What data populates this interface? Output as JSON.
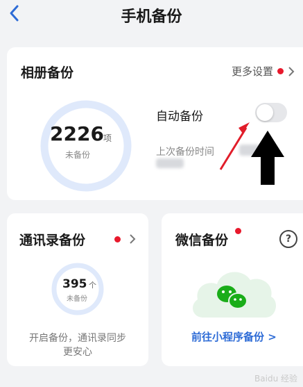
{
  "header": {
    "title": "手机备份"
  },
  "album": {
    "title": "相册备份",
    "more_label": "更多设置",
    "count": "2226",
    "unit": "项",
    "status": "未备份",
    "auto_label": "自动备份",
    "auto_enabled": false,
    "last_backup_label": "上次备份时间"
  },
  "contacts": {
    "title": "通讯录备份",
    "count": "395",
    "unit": "个",
    "status": "未备份",
    "desc_line1": "开启备份，通讯录同步",
    "desc_line2": "更安心"
  },
  "wechat": {
    "title": "微信备份",
    "help_label": "?",
    "link_label": "前往小程序备份 >"
  },
  "watermark": "Baidu 经验",
  "colors": {
    "accent": "#2d6bd6",
    "badge": "#e8192c",
    "ring": "#dfe9fb",
    "wechat_green": "#1aad19",
    "cloud": "#e6f4e8",
    "arrow_red": "#e11d2a"
  },
  "icons": [
    "back-arrow-icon",
    "chevron-right-icon",
    "help-icon",
    "wechat-cloud-icon"
  ]
}
